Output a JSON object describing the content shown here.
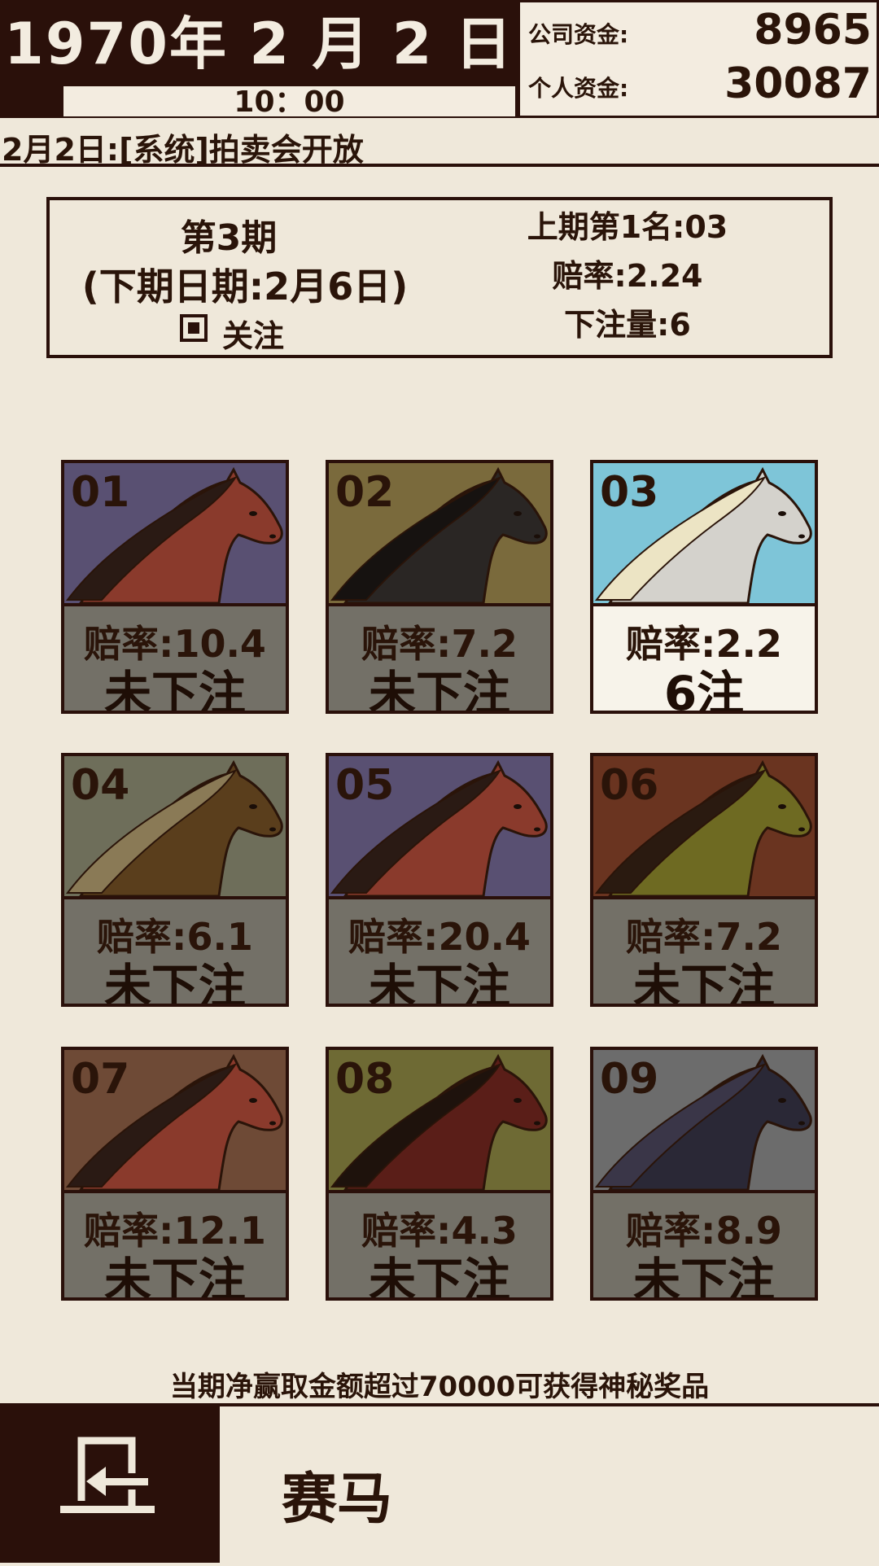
{
  "header": {
    "date": "1970年 2 月 2 日",
    "time": "10：00",
    "company_funds_label": "公司资金:",
    "company_funds": "8965",
    "personal_funds_label": "个人资金:",
    "personal_funds": "30087"
  },
  "news": "2月2日:[系统]拍卖会开放",
  "race": {
    "period": "第3期",
    "next_date": "(下期日期:2月6日)",
    "follow_label": "关注",
    "follow_checked": true,
    "last_winner": "上期第1名:03",
    "odds": "赔率:2.24",
    "bet_amount": "下注量:6"
  },
  "horses": [
    {
      "num": "01",
      "odds": "赔率:10.4",
      "bet": "未下注",
      "bg": "#595072",
      "coat": "#8a3a2c",
      "mane": "#2a1a14",
      "selected": false
    },
    {
      "num": "02",
      "odds": "赔率:7.2",
      "bet": "未下注",
      "bg": "#7a6a3c",
      "coat": "#2a2624",
      "mane": "#161210",
      "selected": false
    },
    {
      "num": "03",
      "odds": "赔率:2.2",
      "bet": "6注",
      "bg": "#7ec5d8",
      "coat": "#d4d2cc",
      "mane": "#ece4c4",
      "selected": true
    },
    {
      "num": "04",
      "odds": "赔率:6.1",
      "bet": "未下注",
      "bg": "#6e6e5a",
      "coat": "#5a3e1c",
      "mane": "#8a7a56",
      "selected": false
    },
    {
      "num": "05",
      "odds": "赔率:20.4",
      "bet": "未下注",
      "bg": "#595072",
      "coat": "#8a3a2c",
      "mane": "#2a1a14",
      "selected": false
    },
    {
      "num": "06",
      "odds": "赔率:7.2",
      "bet": "未下注",
      "bg": "#6a3420",
      "coat": "#6e6a22",
      "mane": "#2a1a10",
      "selected": false
    },
    {
      "num": "07",
      "odds": "赔率:12.1",
      "bet": "未下注",
      "bg": "#6e4a36",
      "coat": "#8a3a2c",
      "mane": "#2a1a14",
      "selected": false
    },
    {
      "num": "08",
      "odds": "赔率:4.3",
      "bet": "未下注",
      "bg": "#6e6a34",
      "coat": "#5a1e18",
      "mane": "#1e120c",
      "selected": false
    },
    {
      "num": "09",
      "odds": "赔率:8.9",
      "bet": "未下注",
      "bg": "#6c6c6c",
      "coat": "#2a2836",
      "mane": "#3a3648",
      "selected": false
    }
  ],
  "promo": "当期净赢取金额超过70000可获得神秘奖品",
  "footer": {
    "page_name": "赛马",
    "exit_icon": "exit-icon"
  }
}
